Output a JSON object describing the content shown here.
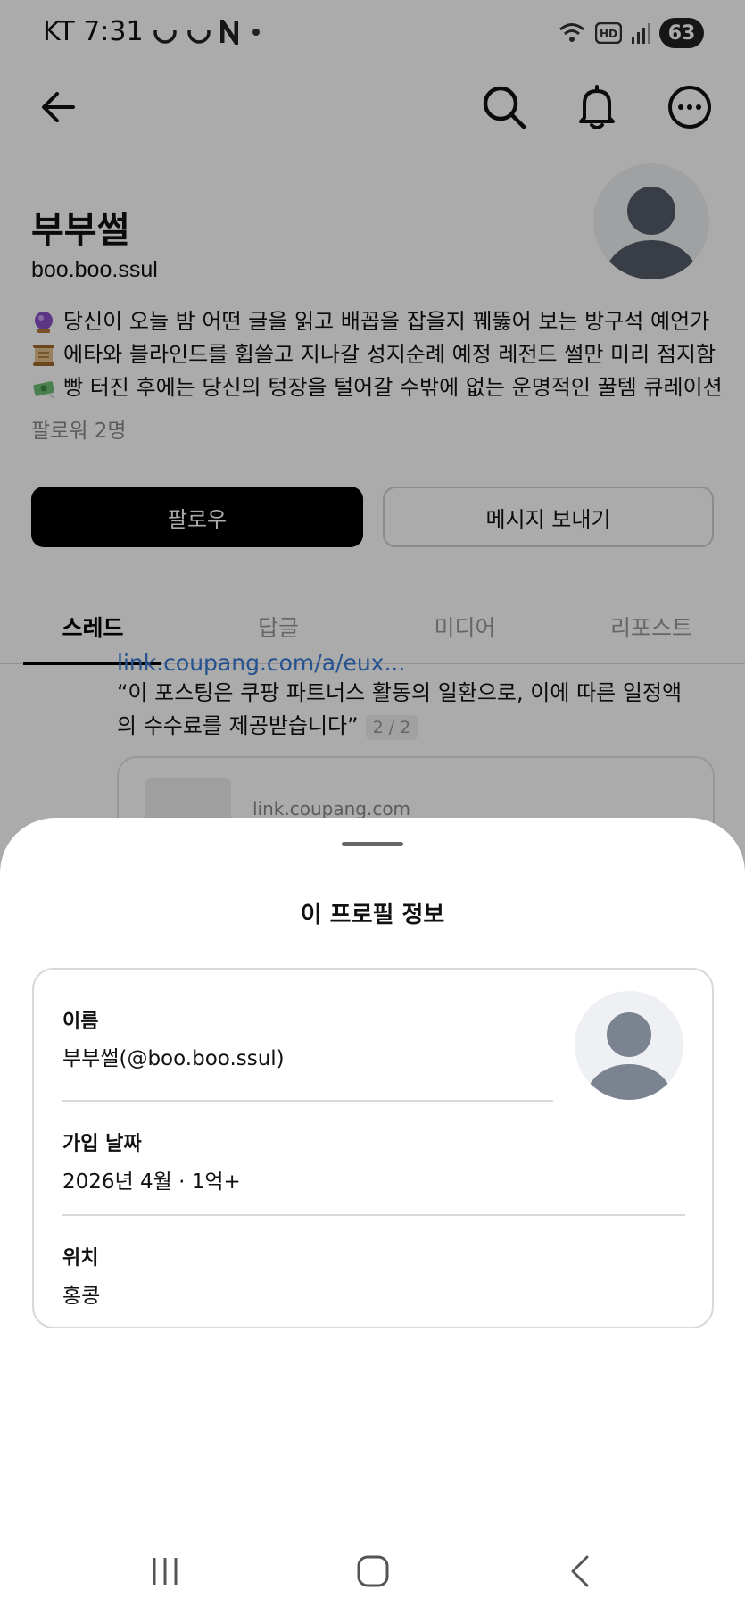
{
  "status_bar": {
    "carrier_time": "KT 7:31",
    "battery": "63",
    "icons": [
      "smile-icon",
      "smile-icon",
      "n-icon",
      "dot-icon",
      "wifi-icon",
      "hd-icon",
      "signal-icon"
    ]
  },
  "nav": {
    "icons": [
      "back-arrow-icon",
      "search-icon",
      "bell-icon",
      "more-icon"
    ]
  },
  "profile": {
    "name": "부부썰",
    "handle": "boo.boo.ssul",
    "bio": [
      {
        "icon": "crystal-ball-icon",
        "text": "당신이 오늘 밤 어떤 글을 읽고 배꼽을 잡을지 꿰뚫어 보는 방구석 예언가"
      },
      {
        "icon": "scroll-icon",
        "text": "에타와 블라인드를 휩쓸고 지나갈 성지순례 예정 레전드 썰만 미리 점지함"
      },
      {
        "icon": "money-icon",
        "text": "빵 터진 후에는 당신의 텅장을 털어갈 수밖에 없는 운명적인 꿀템 큐레이션"
      }
    ],
    "followers": "팔로워 2명",
    "follow_label": "팔로우",
    "message_label": "메시지 보내기"
  },
  "tabs": [
    {
      "label": "스레드",
      "active": true
    },
    {
      "label": "답글",
      "active": false
    },
    {
      "label": "미디어",
      "active": false
    },
    {
      "label": "리포스트",
      "active": false
    }
  ],
  "post": {
    "link": "link.coupang.com/a/eux...",
    "text": "“이 포스팅은 쿠팡 파트너스 활동의 일환으로, 이에 따른 일정액의 수수료를 제공받습니다”",
    "page": "2 / 2",
    "card_domain": "link.coupang.com"
  },
  "sheet": {
    "title": "이 프로필 정보",
    "name_label": "이름",
    "name_value": "부부썰(@boo.boo.ssul)",
    "joined_label": "가입 날짜",
    "joined_value": "2026년 4월 · 1억+",
    "location_label": "위치",
    "location_value": "홍콩"
  },
  "system_nav": [
    "recents-icon",
    "home-icon",
    "back-icon"
  ]
}
